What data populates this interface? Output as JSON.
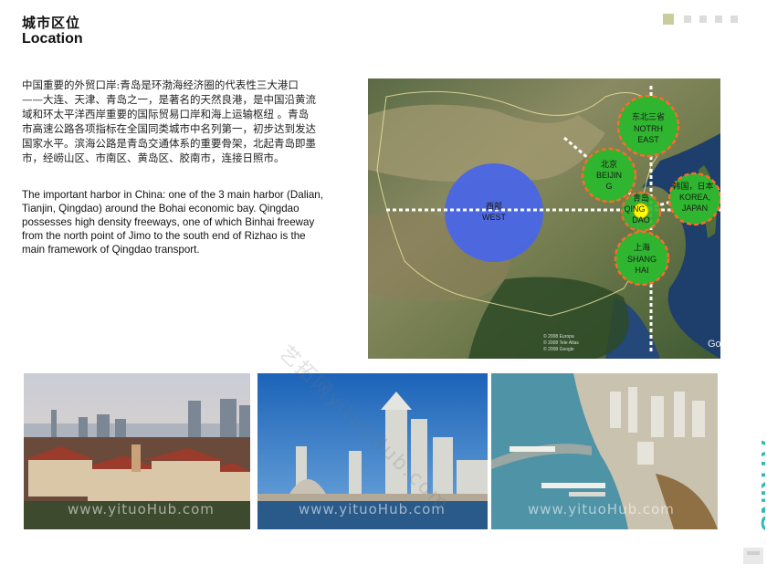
{
  "header": {
    "title_cn": "城市区位",
    "title_en": "Location"
  },
  "pager": {
    "count": 5,
    "active_index": 0
  },
  "body": {
    "paragraph_cn": "中国重要的外贸口岸:青岛是环渤海经济圈的代表性三大港口——大连、天津、青岛之一，是著名的天然良港，是中国沿黄流域和环太平洋西岸重要的国际贸易口岸和海上运输枢纽 。青岛市高速公路各项指标在全国同类城市中名列第一，初步达到发达国家水平。滨海公路是青岛交通体系的重要骨架，北起青岛即墨市，经崂山区、市南区、黄岛区、胶南市，连接日照市。",
    "paragraph_en": "The important harbor in China: one of the 3 main harbor (Dalian, Tianjin, Qingdao) around the Bohai economic bay. Qingdao possesses high density freeways, one of which Binhai freeway from the north point of Jimo to the south end of Rizhao is the main framework of Qingdao transport."
  },
  "map": {
    "regions": [
      {
        "id": "west",
        "cn": "西部",
        "en": "WEST"
      },
      {
        "id": "northeast",
        "cn": "东北三省",
        "en1": "NOTRH",
        "en2": "EAST"
      },
      {
        "id": "beijing",
        "cn": "北京",
        "en1": "BEIJIN",
        "en2": "G"
      },
      {
        "id": "korea",
        "cn": "韩国，日本",
        "en1": "KOREA,",
        "en2": "JAPAN"
      },
      {
        "id": "qingdao",
        "cn": "青岛",
        "en1": "QING",
        "en2": "DAO"
      },
      {
        "id": "shanghai",
        "cn": "上海",
        "en1": "SHANG",
        "en2": "HAI"
      }
    ],
    "credit_lines": [
      "© 2008 Europa",
      "© 2008 Tele Atlas",
      "© 2008 Google"
    ],
    "logo_text": "Go",
    "colors": {
      "west_circle": "#4a66e6",
      "region_circle": "#2fb52f",
      "region_border": "#ff6a2a",
      "qingdao_dot": "#ffff00",
      "axis_line": "#ffffff"
    }
  },
  "photos": [
    {
      "name": "qingdao-old-town",
      "watermark": "www.yituoHub.com"
    },
    {
      "name": "qingdao-skyline",
      "watermark": "www.yituoHub.com"
    },
    {
      "name": "qingdao-harbor-aerial",
      "watermark": "www.yituoHub.com"
    }
  ],
  "watermark_diagonal": "艺拓网yituoHub.com",
  "brand": {
    "name": "ATKINS",
    "color": "#36b7b4"
  }
}
